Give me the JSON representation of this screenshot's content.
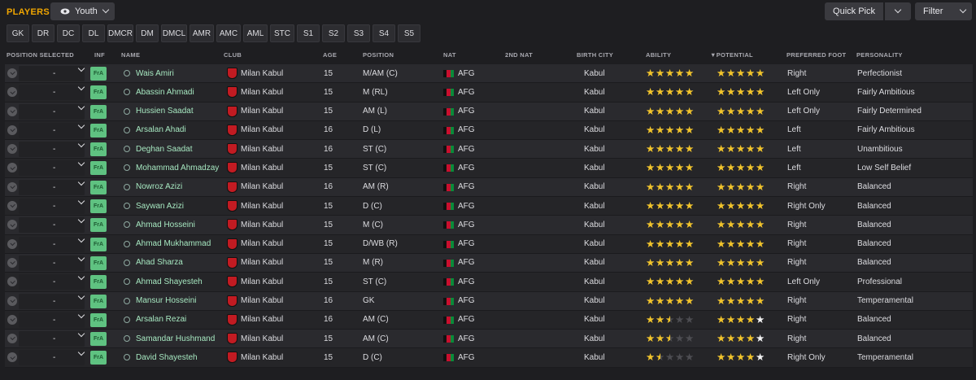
{
  "header": {
    "title": "PLAYERS",
    "view_label": "Youth",
    "quick_pick": "Quick Pick",
    "filter": "Filter"
  },
  "position_filters": [
    "GK",
    "DR",
    "DC",
    "DL",
    "DMCR",
    "DM",
    "DMCL",
    "AMR",
    "AMC",
    "AML",
    "STC",
    "S1",
    "S2",
    "S3",
    "S4",
    "S5"
  ],
  "columns": {
    "position_selected": "POSITION SELECTED",
    "inf": "INF",
    "name": "NAME",
    "club": "CLUB",
    "age": "AGE",
    "position": "POSITION",
    "nat": "NAT",
    "second_nat": "2ND NAT",
    "birth_city": "BIRTH CITY",
    "ability": "ABILITY",
    "potential": "POTENTIAL",
    "preferred_foot": "PREFERRED FOOT",
    "personality": "PERSONALITY"
  },
  "sort_indicator": "▼",
  "colors": {
    "accent": "#f0a500",
    "inf_badge": "#5fc281",
    "player_name": "#a6e7c0",
    "star_gold": "#f3c52a",
    "club_badge": "#c21b22"
  },
  "players": [
    {
      "selected": "-",
      "inf": "FrA",
      "name": "Wais Amiri",
      "club": "Milan Kabul",
      "age": "15",
      "position": "M/AM (C)",
      "nat": "AFG",
      "second_nat": "",
      "birth_city": "Kabul",
      "ability": 5,
      "potential": 5,
      "foot": "Right",
      "personality": "Perfectionist"
    },
    {
      "selected": "-",
      "inf": "FrA",
      "name": "Abassin Ahmadi",
      "club": "Milan Kabul",
      "age": "15",
      "position": "M (RL)",
      "nat": "AFG",
      "second_nat": "",
      "birth_city": "Kabul",
      "ability": 5,
      "potential": 5,
      "foot": "Left Only",
      "personality": "Fairly Ambitious"
    },
    {
      "selected": "-",
      "inf": "FrA",
      "name": "Hussien Saadat",
      "club": "Milan Kabul",
      "age": "15",
      "position": "AM (L)",
      "nat": "AFG",
      "second_nat": "",
      "birth_city": "Kabul",
      "ability": 5,
      "potential": 5,
      "foot": "Left Only",
      "personality": "Fairly Determined"
    },
    {
      "selected": "-",
      "inf": "FrA",
      "name": "Arsalan Ahadi",
      "club": "Milan Kabul",
      "age": "16",
      "position": "D (L)",
      "nat": "AFG",
      "second_nat": "",
      "birth_city": "Kabul",
      "ability": 5,
      "potential": 5,
      "foot": "Left",
      "personality": "Fairly Ambitious"
    },
    {
      "selected": "-",
      "inf": "FrA",
      "name": "Deghan Saadat",
      "club": "Milan Kabul",
      "age": "16",
      "position": "ST (C)",
      "nat": "AFG",
      "second_nat": "",
      "birth_city": "Kabul",
      "ability": 5,
      "potential": 5,
      "foot": "Left",
      "personality": "Unambitious"
    },
    {
      "selected": "-",
      "inf": "FrA",
      "name": "Mohammad Ahmadzay",
      "club": "Milan Kabul",
      "age": "15",
      "position": "ST (C)",
      "nat": "AFG",
      "second_nat": "",
      "birth_city": "Kabul",
      "ability": 5,
      "potential": 5,
      "foot": "Left",
      "personality": "Low Self Belief"
    },
    {
      "selected": "-",
      "inf": "FrA",
      "name": "Nowroz Azizi",
      "club": "Milan Kabul",
      "age": "16",
      "position": "AM (R)",
      "nat": "AFG",
      "second_nat": "",
      "birth_city": "Kabul",
      "ability": 5,
      "potential": 5,
      "foot": "Right",
      "personality": "Balanced"
    },
    {
      "selected": "-",
      "inf": "FrA",
      "name": "Saywan Azizi",
      "club": "Milan Kabul",
      "age": "15",
      "position": "D (C)",
      "nat": "AFG",
      "second_nat": "",
      "birth_city": "Kabul",
      "ability": 5,
      "potential": 5,
      "foot": "Right Only",
      "personality": "Balanced"
    },
    {
      "selected": "-",
      "inf": "FrA",
      "name": "Ahmad Hosseini",
      "club": "Milan Kabul",
      "age": "15",
      "position": "M (C)",
      "nat": "AFG",
      "second_nat": "",
      "birth_city": "Kabul",
      "ability": 5,
      "potential": 5,
      "foot": "Right",
      "personality": "Balanced"
    },
    {
      "selected": "-",
      "inf": "FrA",
      "name": "Ahmad Mukhammad",
      "club": "Milan Kabul",
      "age": "15",
      "position": "D/WB (R)",
      "nat": "AFG",
      "second_nat": "",
      "birth_city": "Kabul",
      "ability": 5,
      "potential": 5,
      "foot": "Right",
      "personality": "Balanced"
    },
    {
      "selected": "-",
      "inf": "FrA",
      "name": "Ahad Sharza",
      "club": "Milan Kabul",
      "age": "15",
      "position": "M (R)",
      "nat": "AFG",
      "second_nat": "",
      "birth_city": "Kabul",
      "ability": 5,
      "potential": 5,
      "foot": "Right",
      "personality": "Balanced"
    },
    {
      "selected": "-",
      "inf": "FrA",
      "name": "Ahmad Shayesteh",
      "club": "Milan Kabul",
      "age": "15",
      "position": "ST (C)",
      "nat": "AFG",
      "second_nat": "",
      "birth_city": "Kabul",
      "ability": 5,
      "potential": 5,
      "foot": "Left Only",
      "personality": "Professional"
    },
    {
      "selected": "-",
      "inf": "FrA",
      "name": "Mansur Hosseini",
      "club": "Milan Kabul",
      "age": "16",
      "position": "GK",
      "nat": "AFG",
      "second_nat": "",
      "birth_city": "Kabul",
      "ability": 5,
      "potential": 5,
      "foot": "Right",
      "personality": "Temperamental"
    },
    {
      "selected": "-",
      "inf": "FrA",
      "name": "Arsalan Rezai",
      "club": "Milan Kabul",
      "age": "16",
      "position": "AM (C)",
      "nat": "AFG",
      "second_nat": "",
      "birth_city": "Kabul",
      "ability": 2.5,
      "potential": 4,
      "potential_extra_white": 1,
      "foot": "Right",
      "personality": "Balanced"
    },
    {
      "selected": "-",
      "inf": "FrA",
      "name": "Samandar Hushmand",
      "club": "Milan Kabul",
      "age": "15",
      "position": "AM (C)",
      "nat": "AFG",
      "second_nat": "",
      "birth_city": "Kabul",
      "ability": 2.5,
      "potential": 4,
      "potential_extra_white": 1,
      "foot": "Right",
      "personality": "Balanced"
    },
    {
      "selected": "-",
      "inf": "FrA",
      "name": "David Shayesteh",
      "club": "Milan Kabul",
      "age": "15",
      "position": "D (C)",
      "nat": "AFG",
      "second_nat": "",
      "birth_city": "Kabul",
      "ability": 1.5,
      "potential": 4,
      "potential_extra_white": 1,
      "foot": "Right Only",
      "personality": "Temperamental"
    }
  ]
}
